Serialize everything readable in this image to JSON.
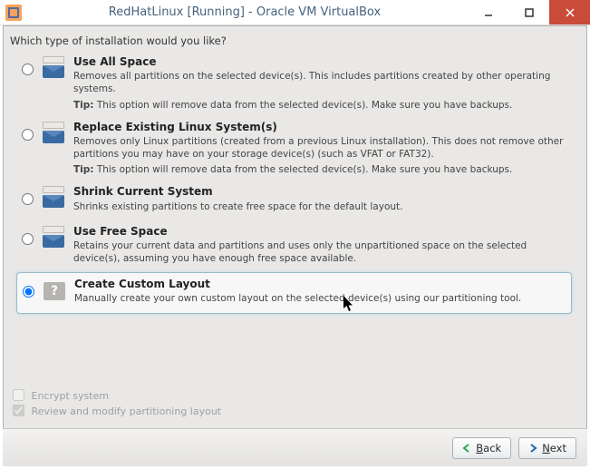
{
  "window": {
    "title": "RedHatLinux [Running] - Oracle VM VirtualBox"
  },
  "installer": {
    "question": "Which type of installation would you like?",
    "options": [
      {
        "title": "Use All Space",
        "desc": "Removes all partitions on the selected device(s).  This includes partitions created by other operating systems.",
        "tip_prefix": "Tip:",
        "tip": " This option will remove data from the selected device(s).  Make sure you have backups.",
        "icon": "env"
      },
      {
        "title": "Replace Existing Linux System(s)",
        "desc": "Removes only Linux partitions (created from a previous Linux installation).  This does not remove other partitions you may have on your storage device(s) (such as VFAT or FAT32).",
        "tip_prefix": "Tip:",
        "tip": " This option will remove data from the selected device(s).  Make sure you have backups.",
        "icon": "env"
      },
      {
        "title": "Shrink Current System",
        "desc": "Shrinks existing partitions to create free space for the default layout.",
        "icon": "env"
      },
      {
        "title": "Use Free Space",
        "desc": "Retains your current data and partitions and uses only the unpartitioned space on the selected device(s), assuming you have enough free space available.",
        "icon": "env"
      },
      {
        "title": "Create Custom Layout",
        "desc": "Manually create your own custom layout on the selected device(s) using our partitioning tool.",
        "icon": "qmark",
        "selected": true
      }
    ],
    "checks": {
      "encrypt": {
        "label": "Encrypt system",
        "checked": false,
        "enabled": false
      },
      "review": {
        "label": "Review and modify partitioning layout",
        "checked": true,
        "enabled": false
      }
    },
    "buttons": {
      "back_prefix": "B",
      "back_rest": "ack",
      "next_prefix": "N",
      "next_rest": "ext"
    }
  }
}
